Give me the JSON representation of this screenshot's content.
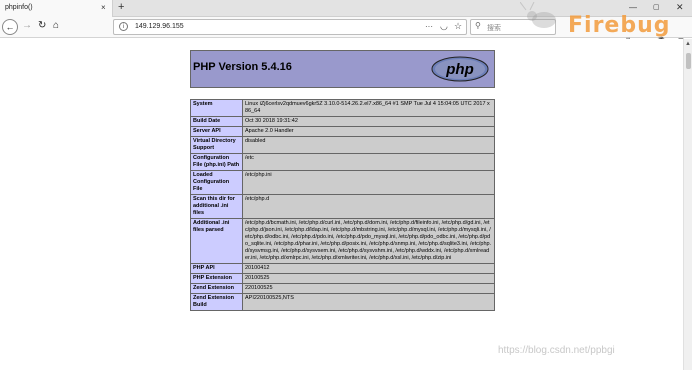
{
  "browser": {
    "tab_title": "phpinfo()",
    "tab_close": "×",
    "new_tab": "+",
    "url": "149.129.96.155",
    "url_more": "···",
    "search_placeholder": "搜索",
    "firebug_label": "Firebug",
    "window_min": "—",
    "window_max": "▢",
    "window_close": "✕"
  },
  "page": {
    "title": "PHP Version 5.4.16",
    "logo_text": "php",
    "rows": [
      {
        "label": "System",
        "value": "Linux iZj6cerlsv2qdmuev6gkr5Z 3.10.0-514.26.2.el7.x86_64 #1 SMP Tue Jul 4 15:04:05 UTC 2017 x86_64"
      },
      {
        "label": "Build Date",
        "value": "Oct 30 2018 19:31:42"
      },
      {
        "label": "Server API",
        "value": "Apache 2.0 Handler"
      },
      {
        "label": "Virtual Directory Support",
        "value": "disabled"
      },
      {
        "label": "Configuration File (php.ini) Path",
        "value": "/etc"
      },
      {
        "label": "Loaded Configuration File",
        "value": "/etc/php.ini"
      },
      {
        "label": "Scan this dir for additional .ini files",
        "value": "/etc/php.d"
      },
      {
        "label": "Additional .ini files parsed",
        "value": "/etc/php.d/bcmath.ini, /etc/php.d/curl.ini, /etc/php.d/dom.ini, /etc/php.d/fileinfo.ini, /etc/php.d/gd.ini, /etc/php.d/json.ini, /etc/php.d/ldap.ini, /etc/php.d/mbstring.ini, /etc/php.d/mysql.ini, /etc/php.d/mysqli.ini, /etc/php.d/odbc.ini, /etc/php.d/pdo.ini, /etc/php.d/pdo_mysql.ini, /etc/php.d/pdo_odbc.ini, /etc/php.d/pdo_sqlite.ini, /etc/php.d/phar.ini, /etc/php.d/posix.ini, /etc/php.d/snmp.ini, /etc/php.d/sqlite3.ini, /etc/php.d/sysvmsg.ini, /etc/php.d/sysvsem.ini, /etc/php.d/sysvshm.ini, /etc/php.d/wddx.ini, /etc/php.d/xmlreader.ini, /etc/php.d/xmlrpc.ini, /etc/php.d/xmlwriter.ini, /etc/php.d/xsl.ini, /etc/php.d/zip.ini"
      },
      {
        "label": "PHP API",
        "value": "20100412"
      },
      {
        "label": "PHP Extension",
        "value": "20100525"
      },
      {
        "label": "Zend Extension",
        "value": "220100525"
      },
      {
        "label": "Zend Extension Build",
        "value": "API220100525,NTS"
      }
    ]
  },
  "watermark": "https://blog.csdn.net/ppbgi",
  "colors": {
    "header_bg": "#9999cc",
    "label_bg": "#ccccff",
    "value_bg": "#cccccc",
    "firebug_orange": "#f39c3c"
  }
}
